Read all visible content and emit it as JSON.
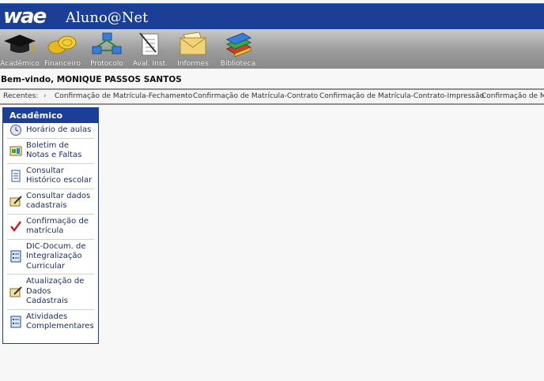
{
  "header": {
    "logo": "wae",
    "app_title": "Aluno@Net"
  },
  "toolbar": {
    "items": [
      {
        "label": "Acadêmico",
        "icon": "graduation-cap-icon"
      },
      {
        "label": "Financeiro",
        "icon": "coins-icon"
      },
      {
        "label": "Protocolo",
        "icon": "network-icon"
      },
      {
        "label": "Aval. Inst.",
        "icon": "checklist-icon"
      },
      {
        "label": "Informes",
        "icon": "envelope-icon"
      },
      {
        "label": "Biblioteca",
        "icon": "books-icon"
      }
    ]
  },
  "welcome": "Bem-vindo, MONIQUE PASSOS SANTOS",
  "recent": {
    "label": "Recentes:",
    "items": [
      "Confirmação de Matrícula-Fechamento",
      "Confirmação de Matrícula-Contrato",
      "Confirmação de Matrícula-Contrato-Impressão",
      "Confirmação de Ma"
    ]
  },
  "sidebar": {
    "title": "Acadêmico",
    "items": [
      {
        "label": "Horário de aulas",
        "icon": "clock-icon"
      },
      {
        "label": "Boletim de Notas e Faltas",
        "icon": "report-icon"
      },
      {
        "label": "Consultar Histórico escolar",
        "icon": "document-icon"
      },
      {
        "label": "Consultar dados cadastrais",
        "icon": "edit-icon"
      },
      {
        "label": "Confirmação de matrícula",
        "icon": "checkmark-icon"
      },
      {
        "label": "DIC-Docum. de Integralização Curricular",
        "icon": "list-document-icon"
      },
      {
        "label": "Atualização de Dados Cadastrais",
        "icon": "edit-icon"
      },
      {
        "label": "Atividades Complementares",
        "icon": "list-document-icon"
      }
    ]
  }
}
